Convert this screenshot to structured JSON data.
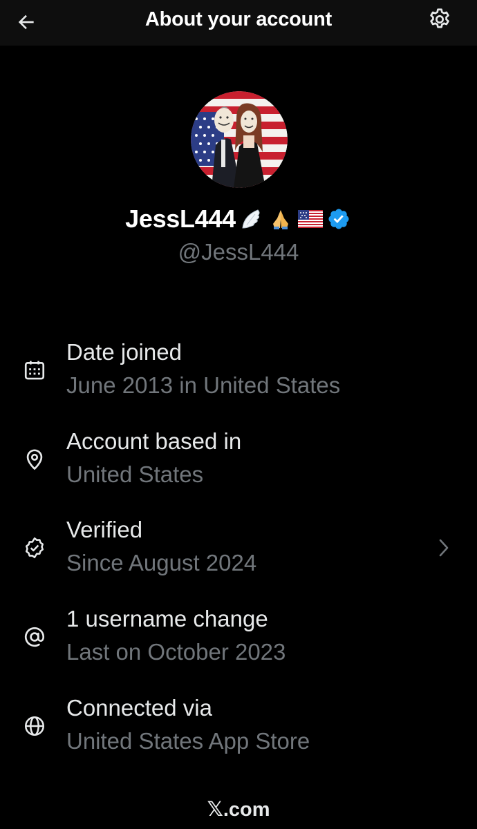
{
  "header": {
    "title": "About your account",
    "back_icon": "arrow-left-icon",
    "settings_icon": "gear-icon"
  },
  "profile": {
    "display_name": "JessL444",
    "emojis": [
      "wing",
      "folded-hands",
      "us-flag"
    ],
    "verified_badge_color": "#1d9bf0",
    "handle": "@JessL444"
  },
  "info": [
    {
      "icon": "calendar-icon",
      "title": "Date joined",
      "value": "June 2013 in United States"
    },
    {
      "icon": "location-pin-icon",
      "title": "Account based in",
      "value": "United States"
    },
    {
      "icon": "verified-badge-icon",
      "title": "Verified",
      "value": "Since August 2024"
    },
    {
      "icon": "at-sign-icon",
      "title": "1 username change",
      "value": "Last on October 2023"
    },
    {
      "icon": "globe-icon",
      "title": "Connected via",
      "value": "United States App Store"
    }
  ],
  "footer": {
    "brand_mark": "𝕏",
    "brand_text": ".com"
  },
  "colors": {
    "background": "#000000",
    "header_bg": "#0e0e0e",
    "primary_text": "#e7e9ea",
    "secondary_text": "#71767b",
    "accent": "#1d9bf0"
  }
}
